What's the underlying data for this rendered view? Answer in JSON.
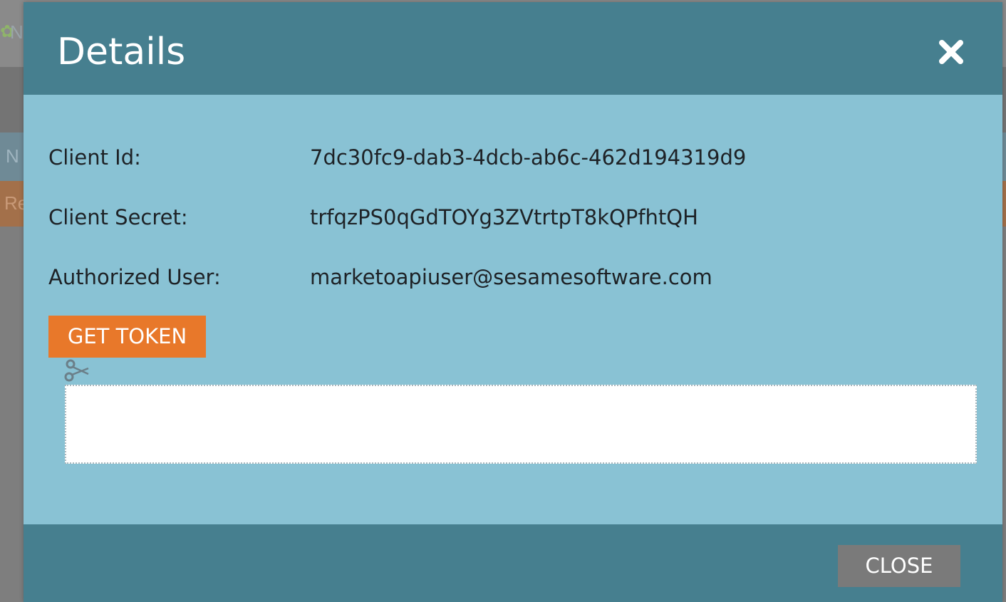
{
  "background": {
    "fragment_top": "N",
    "fragment_mid": "N",
    "fragment_low": "Re"
  },
  "modal": {
    "title": "Details",
    "close_icon": "close-x-icon",
    "fields": [
      {
        "label": "Client Id:",
        "value": "7dc30fc9-dab3-4dcb-ab6c-462d194319d9"
      },
      {
        "label": "Client Secret:",
        "value": "trfqzPS0qGdTOYg3ZVtrtpT8kQPfhtQH"
      },
      {
        "label": "Authorized User:",
        "value": "marketoapiuser@sesamesoftware.com"
      }
    ],
    "get_token_label": "GET TOKEN",
    "copy_icon": "scissors-icon",
    "token_value": "",
    "close_button_label": "CLOSE"
  },
  "colors": {
    "header": "#467f8f",
    "body": "#89c2d4",
    "primary_button": "#e8782a",
    "secondary_button": "#7a7a7a"
  }
}
